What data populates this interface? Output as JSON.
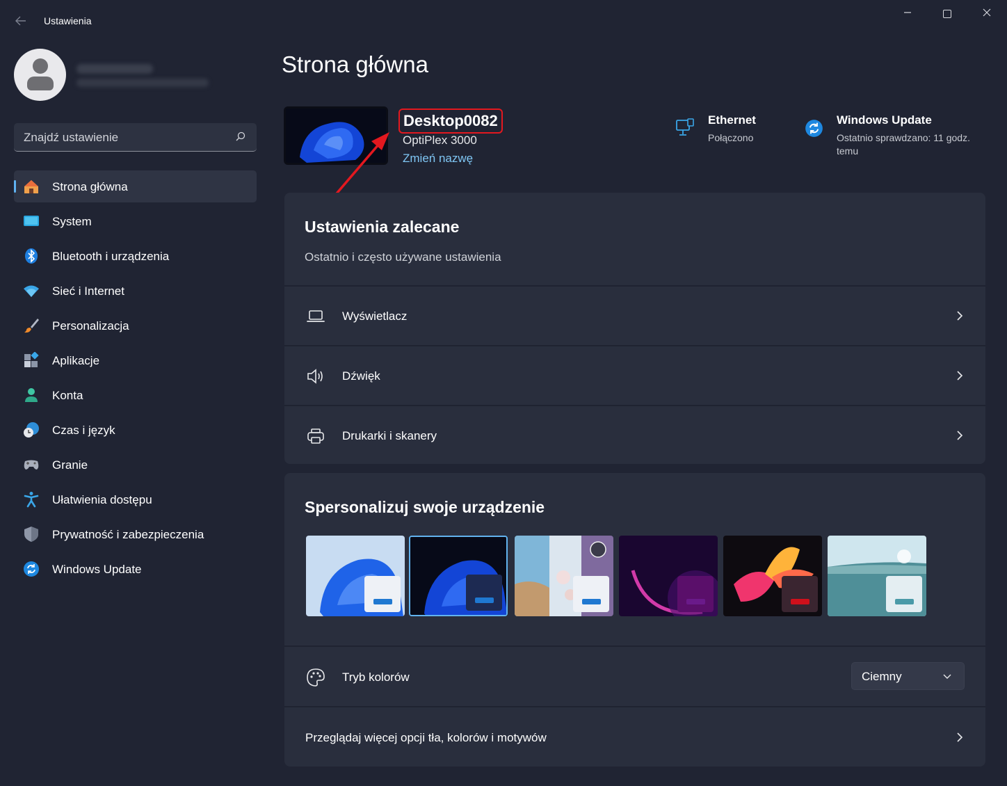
{
  "window": {
    "title": "Ustawienia",
    "back_icon": "arrow-left-icon",
    "minimize_icon": "minimize-icon",
    "maximize_icon": "maximize-icon",
    "close_icon": "close-icon"
  },
  "search": {
    "placeholder": "Znajdź ustawienie",
    "icon": "search-icon"
  },
  "sidebar": {
    "items": [
      {
        "label": "Strona główna",
        "icon": "home-icon",
        "active": true
      },
      {
        "label": "System",
        "icon": "monitor-icon"
      },
      {
        "label": "Bluetooth i urządzenia",
        "icon": "bluetooth-icon"
      },
      {
        "label": "Sieć i Internet",
        "icon": "wifi-icon"
      },
      {
        "label": "Personalizacja",
        "icon": "brush-icon"
      },
      {
        "label": "Aplikacje",
        "icon": "apps-icon"
      },
      {
        "label": "Konta",
        "icon": "account-icon"
      },
      {
        "label": "Czas i język",
        "icon": "globe-clock-icon"
      },
      {
        "label": "Granie",
        "icon": "gamepad-icon"
      },
      {
        "label": "Ułatwienia dostępu",
        "icon": "accessibility-icon"
      },
      {
        "label": "Prywatność i zabezpieczenia",
        "icon": "shield-icon"
      },
      {
        "label": "Windows Update",
        "icon": "update-icon"
      }
    ]
  },
  "main": {
    "title": "Strona główna",
    "device": {
      "name": "Desktop0082",
      "model": "OptiPlex 3000",
      "rename_label": "Zmień nazwę"
    },
    "network": {
      "title": "Ethernet",
      "status": "Połączono",
      "icon": "ethernet-icon"
    },
    "update": {
      "title": "Windows Update",
      "status": "Ostatnio sprawdzano: 11 godz. temu",
      "icon": "update-icon"
    },
    "recommended": {
      "title": "Ustawienia zalecane",
      "subtitle": "Ostatnio i często używane ustawienia",
      "items": [
        {
          "label": "Wyświetlacz",
          "icon": "laptop-icon"
        },
        {
          "label": "Dźwięk",
          "icon": "speaker-icon"
        },
        {
          "label": "Drukarki i skanery",
          "icon": "printer-icon"
        }
      ]
    },
    "personalize": {
      "title": "Spersonalizuj swoje urządzenie",
      "themes": [
        {
          "name": "windows-light-theme",
          "selected": false
        },
        {
          "name": "windows-dark-theme",
          "selected": true
        },
        {
          "name": "windows-spotlight-theme",
          "selected": false
        },
        {
          "name": "glow-theme",
          "selected": false
        },
        {
          "name": "captured-motion-theme",
          "selected": false
        },
        {
          "name": "flow-theme",
          "selected": false
        }
      ],
      "color_mode": {
        "label": "Tryb kolorów",
        "value": "Ciemny",
        "icon": "palette-icon"
      },
      "more_label": "Przeglądaj więcej opcji tła, kolorów i motywów"
    }
  },
  "colors": {
    "background": "#202433",
    "card": "#292e3d",
    "accent": "#5fb2f2",
    "highlight_annotation": "#e3181f"
  }
}
